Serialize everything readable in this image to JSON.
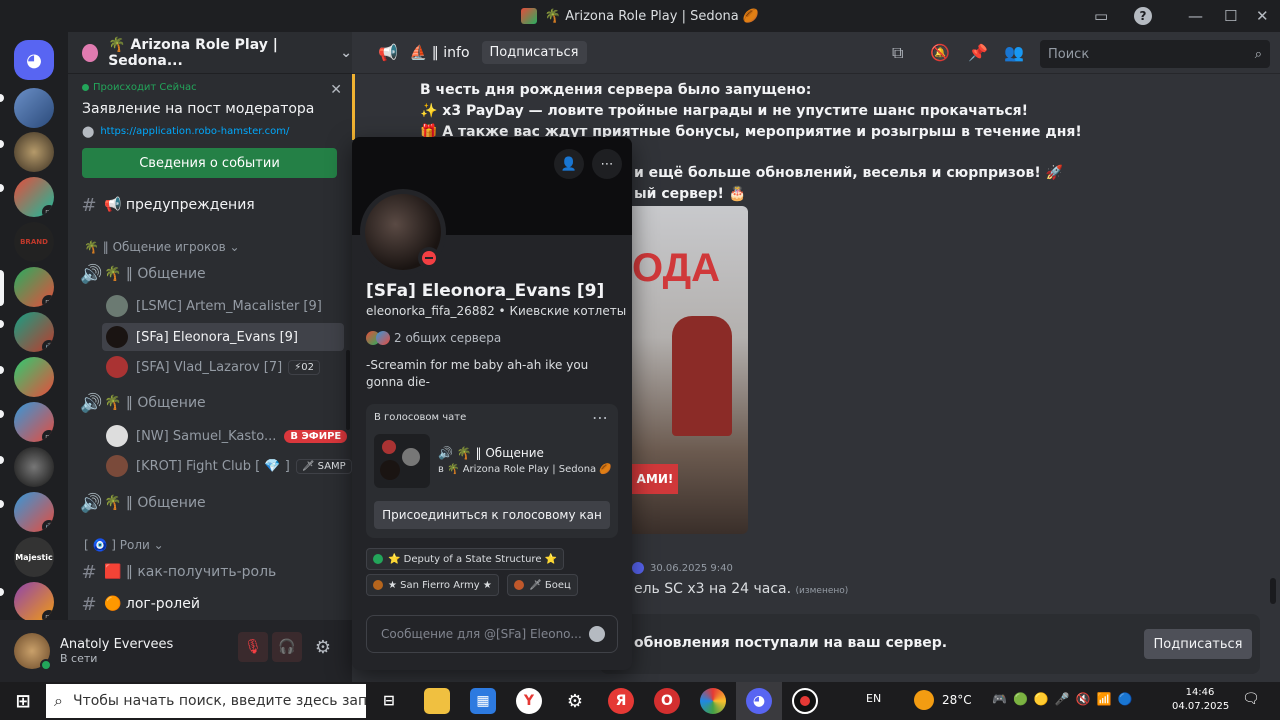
{
  "window": {
    "title": "🌴 Arizona Role Play | Sedona 🏉"
  },
  "sidebar": {
    "server_name": "🌴 Arizona Role Play | Sedona...",
    "event": {
      "status": "Происходит Сейчас",
      "title": "Заявление на пост модератора",
      "link": "https://application.robo-hamster.com/",
      "button": "Сведения о событии"
    },
    "channels": [
      {
        "name": "📢 предупреждения"
      },
      {
        "category": "🌴 ‖ Общение игроков"
      },
      {
        "name": "🌴 ‖ Общение",
        "voice": true
      },
      {
        "name": "🌴 ‖ Общение",
        "voice": true
      },
      {
        "name": "🌴 ‖ Общение",
        "voice": true
      },
      {
        "category": "[ 🧿 ] Роли"
      },
      {
        "name": "🟥 ‖ как-получить-роль"
      },
      {
        "name": "🟠 лог-ролей"
      }
    ],
    "voice_users": [
      {
        "name": "[LSMC] Artem_Macalister [9]"
      },
      {
        "name": "[SFa] Eleonora_Evans [9]"
      },
      {
        "name": "[SFA] Vlad_Lazarov [7]",
        "tag": "⚡02"
      },
      {
        "name": "[NW] Samuel_Kasto...",
        "badge": "В ЭФИРЕ"
      },
      {
        "name": "[KROT] Fight Club [ 💎 ]",
        "tag": "🗡 SAMP"
      }
    ]
  },
  "user_panel": {
    "name": "Anatoly Evervees",
    "status": "В сети"
  },
  "header": {
    "channel": "⛵ ‖ info",
    "subscribe": "Подписаться",
    "search_placeholder": "Поиск"
  },
  "messages": {
    "line1": "В честь дня рождения сервера было запущено:",
    "line2": "✨ x3 PayDay — ловите тройные награды и не упустите шанс прокачаться!",
    "line3": "🎁 А также вас ждут приятные бонусы, мероприятие и розыгрыш в течение дня!",
    "line4": "и ещё больше обновлений, веселья и сюрпризов! 🚀",
    "line5": "ый сервер! 🎂",
    "image_text_top": "ОДА",
    "image_text_bottom": "АМИ!",
    "timestamp": "30.06.2025 9:40",
    "line6": "ель SC x3 на 24 часа.",
    "edited": "(изменено)",
    "subscribe_bar": "обновления поступали на ваш сервер.",
    "subscribe_bar_button": "Подписаться"
  },
  "popout": {
    "display_name": "[SFa] Eleonora_Evans [9]",
    "username": "eleonorka_fifa_26882",
    "pronouns": "Киевские котлеты",
    "mutual_servers": "2 общих сервера",
    "bio": "-Screamin for me baby ah-ah ike you gonna die-",
    "voice_section_title": "В голосовом чате",
    "voice_channel": "🌴 ‖ Общение",
    "voice_server": "в 🌴 Arizona Role Play | Sedona 🏉",
    "join_button": "Присоединиться к голосовому кан",
    "roles": [
      {
        "name": "⭐ Deputy of a State Structure ⭐",
        "color": "#23a55a"
      },
      {
        "name": "★ San Fierro Army ★",
        "color": "#b5651d"
      },
      {
        "name": "🗡 Боец",
        "color": "#c0582b"
      }
    ],
    "message_placeholder": "Сообщение для @[SFa] Eleono..."
  },
  "taskbar": {
    "search": "Чтобы начать поиск, введите здесь запрос",
    "lang": "EN",
    "weather": "28°C",
    "time": "14:46",
    "date": "04.07.2025"
  },
  "colors": {
    "accent_green": "#248046",
    "dnd": "#f23f43",
    "bg": "#313338"
  }
}
